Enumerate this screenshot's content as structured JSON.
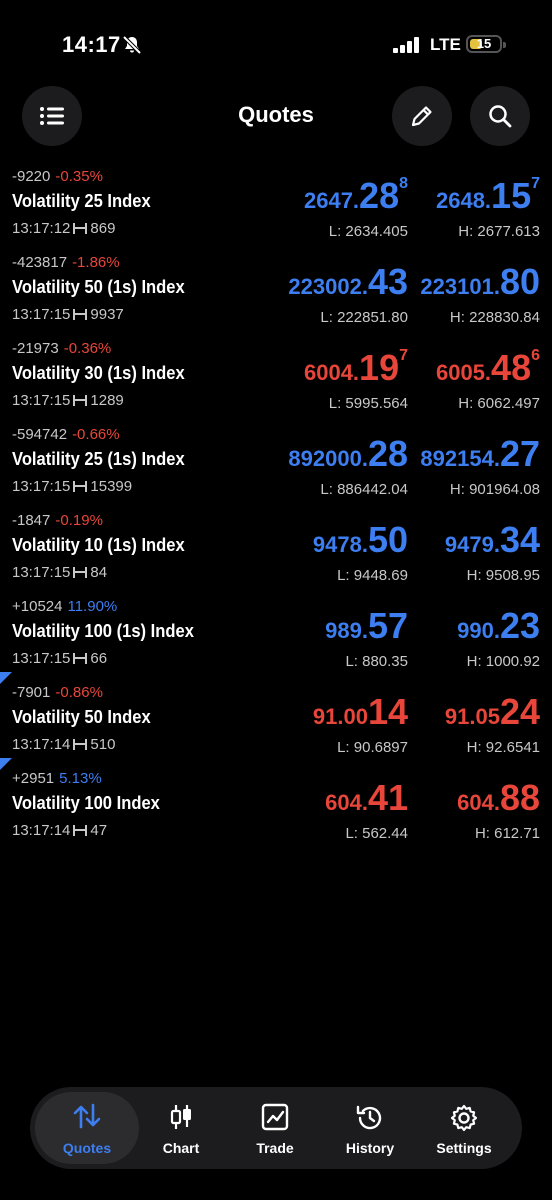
{
  "status": {
    "time": "14:17",
    "network": "LTE",
    "battery": "15"
  },
  "header": {
    "title": "Quotes",
    "left_icon": "list-icon",
    "right_icons": [
      "pencil-icon",
      "search-icon"
    ]
  },
  "quotes": [
    {
      "change": "-9220",
      "pct": "-0.35%",
      "pct_color": "red",
      "name": "Volatility 25 Index",
      "time": "13:17:12",
      "spread": "869",
      "bid": {
        "a": "2647.",
        "b": "28",
        "c": "8",
        "color": "blue"
      },
      "ask": {
        "a": "2648.",
        "b": "15",
        "c": "7",
        "color": "blue"
      },
      "low": "L: 2634.405",
      "high": "H: 2677.613",
      "corner": false
    },
    {
      "change": "-423817",
      "pct": "-1.86%",
      "pct_color": "red",
      "name": "Volatility 50 (1s) Index",
      "time": "13:17:15",
      "spread": "9937",
      "bid": {
        "a": "223002.",
        "b": "43",
        "c": "",
        "color": "blue"
      },
      "ask": {
        "a": "223101.",
        "b": "80",
        "c": "",
        "color": "blue"
      },
      "low": "L: 222851.80",
      "high": "H: 228830.84",
      "corner": false
    },
    {
      "change": "-21973",
      "pct": "-0.36%",
      "pct_color": "red",
      "name": "Volatility 30 (1s) Index",
      "time": "13:17:15",
      "spread": "1289",
      "bid": {
        "a": "6004.",
        "b": "19",
        "c": "7",
        "color": "red"
      },
      "ask": {
        "a": "6005.",
        "b": "48",
        "c": "6",
        "color": "red"
      },
      "low": "L: 5995.564",
      "high": "H: 6062.497",
      "corner": false
    },
    {
      "change": "-594742",
      "pct": "-0.66%",
      "pct_color": "red",
      "name": "Volatility 25 (1s) Index",
      "time": "13:17:15",
      "spread": "15399",
      "bid": {
        "a": "892000.",
        "b": "28",
        "c": "",
        "color": "blue"
      },
      "ask": {
        "a": "892154.",
        "b": "27",
        "c": "",
        "color": "blue"
      },
      "low": "L: 886442.04",
      "high": "H: 901964.08",
      "corner": false
    },
    {
      "change": "-1847",
      "pct": "-0.19%",
      "pct_color": "red",
      "name": "Volatility 10 (1s) Index",
      "time": "13:17:15",
      "spread": "84",
      "bid": {
        "a": "9478.",
        "b": "50",
        "c": "",
        "color": "blue"
      },
      "ask": {
        "a": "9479.",
        "b": "34",
        "c": "",
        "color": "blue"
      },
      "low": "L: 9448.69",
      "high": "H: 9508.95",
      "corner": false
    },
    {
      "change": "+10524",
      "pct": "11.90%",
      "pct_color": "blue",
      "name": "Volatility 100 (1s) Index",
      "time": "13:17:15",
      "spread": "66",
      "bid": {
        "a": "989.",
        "b": "57",
        "c": "",
        "color": "blue"
      },
      "ask": {
        "a": "990.",
        "b": "23",
        "c": "",
        "color": "blue"
      },
      "low": "L: 880.35",
      "high": "H: 1000.92",
      "corner": false
    },
    {
      "change": "-7901",
      "pct": "-0.86%",
      "pct_color": "red",
      "name": "Volatility 50 Index",
      "time": "13:17:14",
      "spread": "510",
      "bid": {
        "a": "91.00",
        "b": "14",
        "c": "",
        "color": "red"
      },
      "ask": {
        "a": "91.05",
        "b": "24",
        "c": "",
        "color": "red"
      },
      "low": "L: 90.6897",
      "high": "H: 92.6541",
      "corner": true
    },
    {
      "change": "+2951",
      "pct": "5.13%",
      "pct_color": "blue",
      "name": "Volatility 100 Index",
      "time": "13:17:14",
      "spread": "47",
      "bid": {
        "a": "604.",
        "b": "41",
        "c": "",
        "color": "red"
      },
      "ask": {
        "a": "604.",
        "b": "88",
        "c": "",
        "color": "red"
      },
      "low": "L: 562.44",
      "high": "H: 612.71",
      "corner": true
    }
  ],
  "tabs": [
    {
      "label": "Quotes",
      "icon": "quotes-arrows-icon",
      "active": true
    },
    {
      "label": "Chart",
      "icon": "candlestick-icon",
      "active": false
    },
    {
      "label": "Trade",
      "icon": "trade-chart-icon",
      "active": false
    },
    {
      "label": "History",
      "icon": "history-clock-icon",
      "active": false
    },
    {
      "label": "Settings",
      "icon": "gear-icon",
      "active": false
    }
  ],
  "colors": {
    "blue": "#3d7ef1",
    "red": "#e8463a",
    "background": "#000000",
    "surface": "#1c1c1e"
  }
}
